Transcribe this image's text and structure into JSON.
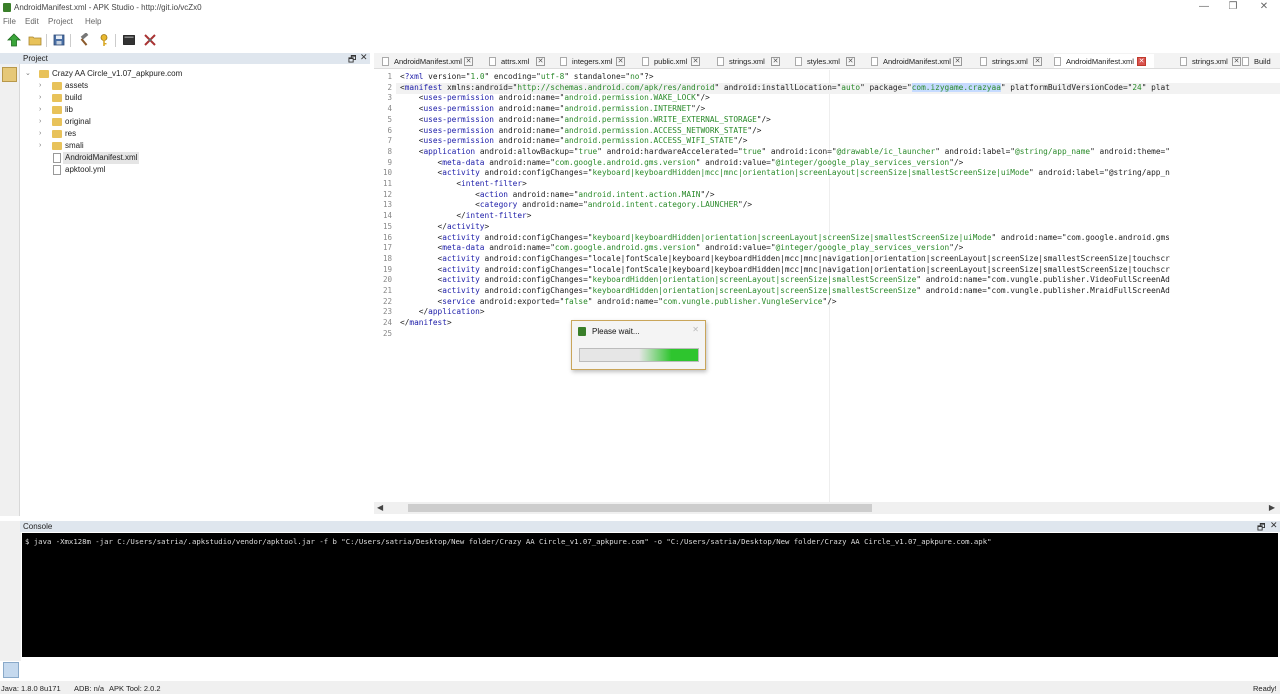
{
  "window": {
    "title": "AndroidManifest.xml - APK Studio - http://git.io/vcZx0",
    "controls": [
      "—",
      "❐",
      "✕"
    ]
  },
  "menu": [
    "File",
    "Edit",
    "Project",
    "Help"
  ],
  "toolbar": {
    "icons": [
      "build-apk-icon",
      "open-folder-icon",
      "save-icon",
      "hammer-icon",
      "key-icon",
      "terminal-icon",
      "tools-icon"
    ]
  },
  "project_panel": {
    "title": "Project",
    "float_glyph": "🗗",
    "close_glyph": "✕",
    "root": "Crazy AA Circle_v1.07_apkpure.com",
    "folders": [
      "assets",
      "build",
      "lib",
      "original",
      "res",
      "smali"
    ],
    "files": [
      "AndroidManifest.xml",
      "apktool.yml"
    ],
    "selected_file": "AndroidManifest.xml"
  },
  "tabs": [
    {
      "label": "AndroidManifest.xml",
      "active": false
    },
    {
      "label": "attrs.xml",
      "active": false
    },
    {
      "label": "integers.xml",
      "active": false
    },
    {
      "label": "public.xml",
      "active": false
    },
    {
      "label": "strings.xml",
      "active": false
    },
    {
      "label": "styles.xml",
      "active": false
    },
    {
      "label": "AndroidManifest.xml",
      "active": false
    },
    {
      "label": "strings.xml",
      "active": false
    },
    {
      "label": "AndroidManifest.xml",
      "active": true
    },
    {
      "label": "strings.xml",
      "active": false
    },
    {
      "label": "Build",
      "active": false
    }
  ],
  "editor": {
    "current_line": 2,
    "line_numbers": [
      "1",
      "2",
      "3",
      "4",
      "5",
      "6",
      "7",
      "8",
      "9",
      "10",
      "11",
      "12",
      "13",
      "14",
      "15",
      "16",
      "17",
      "18",
      "19",
      "20",
      "21",
      "22",
      "23",
      "24",
      "25"
    ],
    "lines": [
      "<?xml version=\"1.0\" encoding=\"utf-8\" standalone=\"no\"?>",
      "<manifest xmlns:android=\"http://schemas.android.com/apk/res/android\" android:installLocation=\"auto\" package=\"com.izygame.crazyaa\" platformBuildVersionCode=\"24\" plat",
      "    <uses-permission android:name=\"android.permission.WAKE_LOCK\"/>",
      "    <uses-permission android:name=\"android.permission.INTERNET\"/>",
      "    <uses-permission android:name=\"android.permission.WRITE_EXTERNAL_STORAGE\"/>",
      "    <uses-permission android:name=\"android.permission.ACCESS_NETWORK_STATE\"/>",
      "    <uses-permission android:name=\"android.permission.ACCESS_WIFI_STATE\"/>",
      "    <application android:allowBackup=\"true\" android:hardwareAccelerated=\"true\" android:icon=\"@drawable/ic_launcher\" android:label=\"@string/app_name\" android:theme=\"",
      "        <meta-data android:name=\"com.google.android.gms.version\" android:value=\"@integer/google_play_services_version\"/>",
      "        <activity android:configChanges=\"keyboard|keyboardHidden|mcc|mnc|orientation|screenLayout|screenSize|smallestScreenSize|uiMode\" android:label=\"@string/app_n",
      "            <intent-filter>",
      "                <action android:name=\"android.intent.action.MAIN\"/>",
      "                <category android:name=\"android.intent.category.LAUNCHER\"/>",
      "            </intent-filter>",
      "        </activity>",
      "        <activity android:configChanges=\"keyboard|keyboardHidden|orientation|screenLayout|screenSize|smallestScreenSize|uiMode\" android:name=\"com.google.android.gms",
      "        <meta-data android:name=\"com.google.android.gms.version\" android:value=\"@integer/google_play_services_version\"/>",
      "        <activity android:configChanges=\"locale|fontScale|keyboard|keyboardHidden|mcc|mnc|navigation|orientation|screenLayout|screenSize|smallestScreenSize|touchscr",
      "        <activity android:configChanges=\"locale|fontScale|keyboard|keyboardHidden|mcc|mnc|navigation|orientation|screenLayout|screenSize|smallestScreenSize|touchscr",
      "        <activity android:configChanges=\"keyboardHidden|orientation|screenLayout|screenSize|smallestScreenSize\" android:name=\"com.vungle.publisher.VideoFullScreenAd",
      "        <activity android:configChanges=\"keyboardHidden|orientation|screenLayout|screenSize|smallestScreenSize\" android:name=\"com.vungle.publisher.MraidFullScreenAd",
      "        <service android:exported=\"false\" android:name=\"com.vungle.publisher.VungleService\"/>",
      "    </application>",
      "</manifest>",
      ""
    ]
  },
  "dialog": {
    "title": "Please wait...",
    "close_glyph": "✕",
    "progress": 0.5
  },
  "console": {
    "title": "Console",
    "float_glyph": "🗗",
    "close_glyph": "✕",
    "command": "$ java -Xmx128m -jar C:/Users/satria/.apkstudio/vendor/apktool.jar -f b \"C:/Users/satria/Desktop/New folder/Crazy AA Circle_v1.07_apkpure.com\" -o \"C:/Users/satria/Desktop/New folder/Crazy AA Circle_v1.07_apkpure.com.apk\""
  },
  "status": {
    "java": "Java: 1.8.0 8u171",
    "adb": "ADB: n/a",
    "apktool": "APK Tool: 2.0.2",
    "ready": "Ready!"
  },
  "colors": {
    "tag": "#1b1ba8",
    "value": "#2a8a2a",
    "progress": "#2ec52e",
    "active_tab_close": "#d9534f"
  }
}
